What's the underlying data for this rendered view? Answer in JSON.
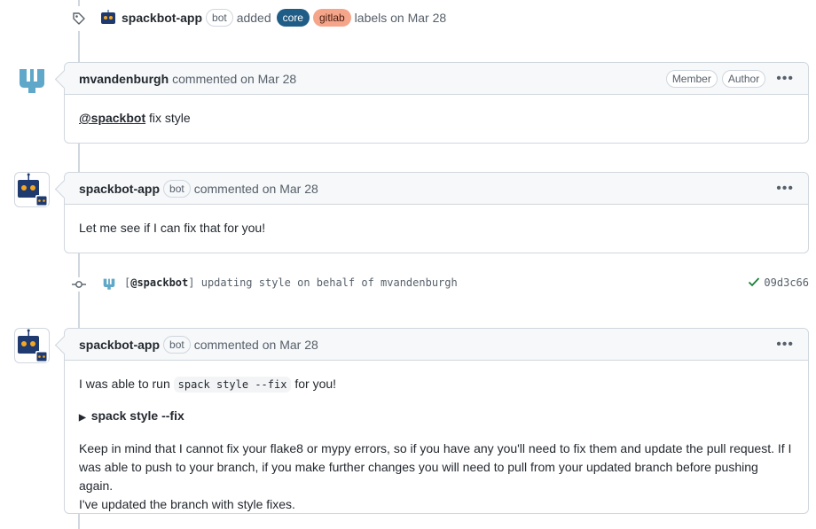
{
  "label_event": {
    "actor": "spackbot-app",
    "bot_badge": "bot",
    "verb": "added",
    "labels": [
      {
        "name": "core",
        "bg": "#1f5d87",
        "fg": "#ffffff"
      },
      {
        "name": "gitlab",
        "bg": "#f4a58a",
        "fg": "#4a1d10"
      }
    ],
    "suffix": "labels on Mar 28"
  },
  "comments": [
    {
      "author": "mvandenburgh",
      "meta": "commented on Mar 28",
      "badges": [
        "Member",
        "Author"
      ],
      "mention": "@spackbot",
      "text": "fix style"
    },
    {
      "author": "spackbot-app",
      "bot_badge": "bot",
      "meta": "commented on Mar 28",
      "text": "Let me see if I can fix that for you!"
    },
    {
      "author": "spackbot-app",
      "bot_badge": "bot",
      "meta": "commented on Mar 28",
      "text_before": "I was able to run",
      "code": "spack style --fix",
      "text_after": "for you!",
      "details_summary": "spack style --fix",
      "paragraph": "Keep in mind that I cannot fix your flake8 or mypy errors, so if you have any you'll need to fix them and update the pull request. If I was able to push to your branch, if you make further changes you will need to pull from your updated branch before pushing again.",
      "paragraph2": "I've updated the branch with style fixes."
    }
  ],
  "commit": {
    "bracket_open": "[",
    "mention": "@spackbot",
    "bracket_close": "]",
    "message": "updating style on behalf of mvandenburgh",
    "sha": "09d3c66"
  },
  "colors": {
    "bot_navy": "#1e3a6e",
    "bot_eyes": "#f5a623",
    "mv_teal": "#5fa8c9"
  }
}
